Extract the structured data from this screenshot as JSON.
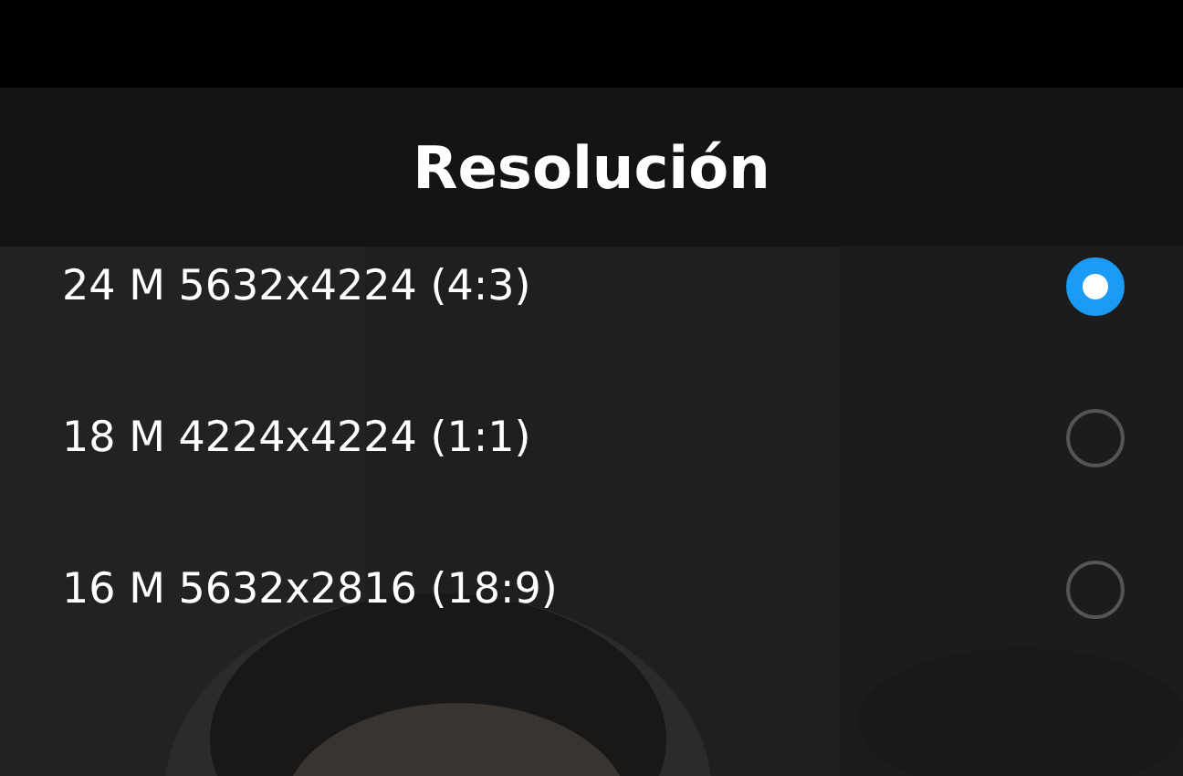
{
  "header": {
    "title": "Resolución"
  },
  "options": [
    {
      "label": "24 M 5632x4224 (4:3)",
      "selected": true
    },
    {
      "label": "18 M 4224x4224 (1:1)",
      "selected": false
    },
    {
      "label": "16 M 5632x2816 (18:9)",
      "selected": false
    }
  ]
}
